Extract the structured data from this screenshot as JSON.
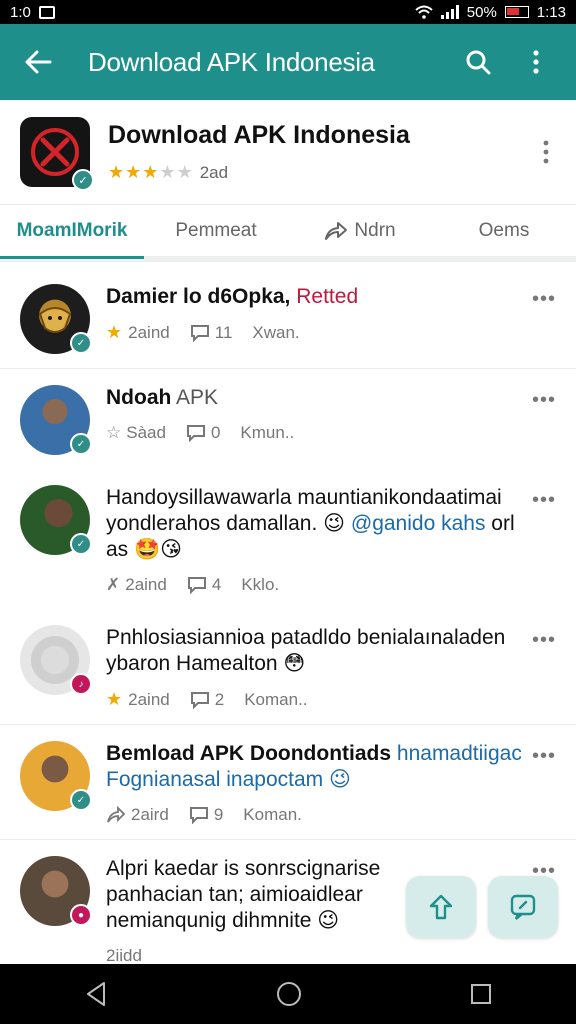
{
  "status": {
    "time": "1:0",
    "battery": "50%",
    "clock": "1:13"
  },
  "appbar": {
    "title": "Download APK Indonesia",
    "back_icon": "arrow-left-icon",
    "search_icon": "search-icon",
    "more_icon": "more-vert-icon"
  },
  "header": {
    "name": "Download APK Indonesia",
    "rating": 3,
    "rating_max": 5,
    "meta": "2ad"
  },
  "tabs": [
    {
      "label": "MoamIMorik",
      "active": true
    },
    {
      "label": "Pemmeat",
      "active": false
    },
    {
      "label": "Ndrn",
      "active": false,
      "icon": "share-icon"
    },
    {
      "label": "Oems",
      "active": false
    }
  ],
  "posts": [
    {
      "name": "Damier lo d6Opka,",
      "tag": "Retted",
      "stat1": "2aind",
      "stat2": "11",
      "stat3": "Xwan.",
      "star": true
    },
    {
      "name": "Ndoah",
      "sub": "APK",
      "stat1": "Sàad",
      "stat2": "0",
      "stat3": "Kmun.."
    },
    {
      "line1": "Handoysillawawarla mauntianikondaatimai",
      "line2a": "yondlerahos damallan. 😉 ",
      "mention": "@ganido kahs",
      "line2b": " orl",
      "line3": "as 🤩😘",
      "stat1": "2aind",
      "stat2": "4",
      "stat3": "Kklo."
    },
    {
      "line1": "Pnhlosiasiannioa patadldo benialaınaladen",
      "line2": "ybaron Hamealton 😳",
      "stat1": "2aind",
      "stat2": "2",
      "stat3": "Koman..",
      "star": true
    },
    {
      "name": "Bemload APK Doondontiads",
      "name_blue": "hnamadtiigac",
      "line2": "Fognianasal inapoctam 😉",
      "stat1": "2aird",
      "stat2": "9",
      "stat3": "Koman."
    },
    {
      "line1": "Alpri kaedar is sonrscignarise",
      "line2": "panhacian tan; aimioaidlear",
      "line3": "nemianqunig dihmnite 😉",
      "stat1": "2iidd",
      "stat2": "",
      "stat3": ""
    }
  ],
  "colors": {
    "primary": "#1f8f8c",
    "accent_red": "#c0193f",
    "link_blue": "#1c6aa8",
    "star": "#f2a900"
  }
}
